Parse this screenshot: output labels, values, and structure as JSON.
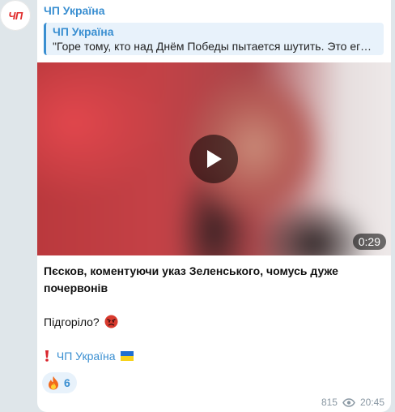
{
  "channel": {
    "avatar_text": "ЧП",
    "sender": "ЧП Україна"
  },
  "reply": {
    "name": "ЧП Україна",
    "text": "\"Горе тому, кто над Днём Победы пытается шутить. Это его …"
  },
  "video": {
    "duration": "0:29"
  },
  "post": {
    "line1": "Пєсков, коментуючи указ Зеленського, чомусь дуже",
    "line2": "почервонів",
    "question": "Підгоріло?",
    "footer_link": "ЧП Україна"
  },
  "reaction": {
    "emoji": "fire",
    "count": "6"
  },
  "meta": {
    "views": "815",
    "time": "20:45"
  },
  "colors": {
    "accent": "#3a8fd1",
    "brand_red": "#e02b2b"
  }
}
